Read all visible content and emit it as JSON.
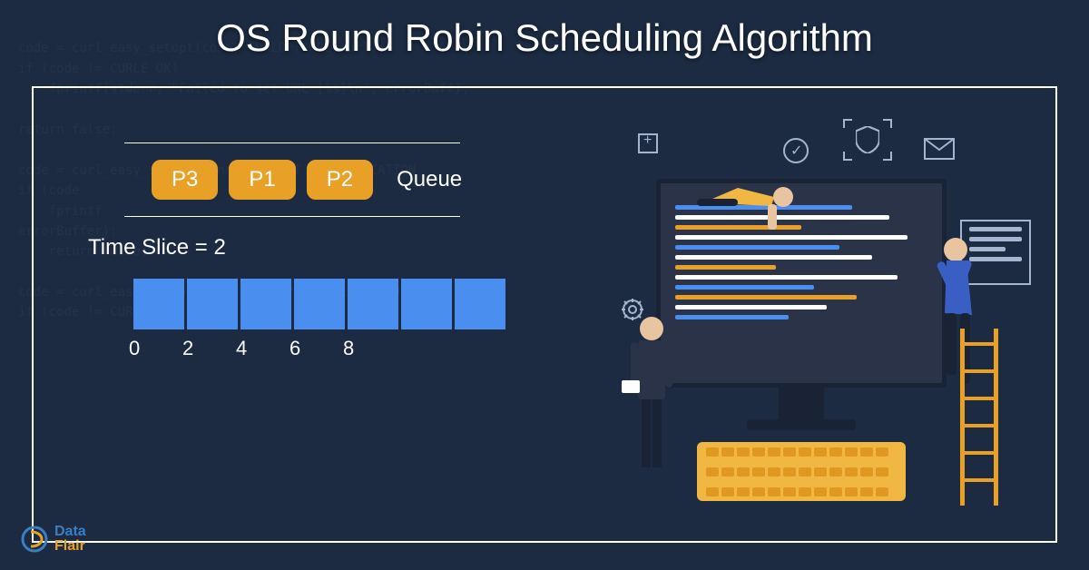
{
  "title": "OS Round Robin Scheduling Algorithm",
  "queue": {
    "items": [
      "P3",
      "P1",
      "P2"
    ],
    "label": "Queue"
  },
  "time_slice": {
    "label": "Time Slice = 2",
    "value": 2
  },
  "timeline": {
    "cells": 7,
    "ticks": [
      "0",
      "2",
      "4",
      "6",
      "8"
    ]
  },
  "logo": {
    "brand_part1": "Data",
    "brand_part2": "Flair"
  },
  "colors": {
    "pill": "#e8a126",
    "cell": "#4a8ff0",
    "bg": "#1c2b42"
  }
}
